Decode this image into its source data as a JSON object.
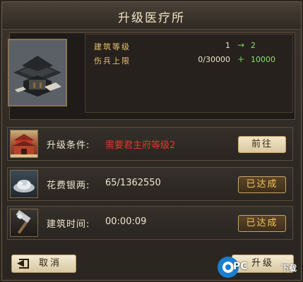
{
  "dialog": {
    "title": "升级医疗所"
  },
  "stats": [
    {
      "label": "建筑等级",
      "current": "1",
      "operator": "→",
      "next": "2"
    },
    {
      "label": "伤兵上限",
      "current": "0/30000",
      "operator": "+",
      "next": "10000"
    }
  ],
  "requirement": {
    "label": "升级条件:",
    "value": "需要君主府等级2",
    "value_color": "#e0392b",
    "button": "前往"
  },
  "cost": {
    "label": "花费银两:",
    "value": "65/1362550",
    "status": "已达成"
  },
  "build_time": {
    "label": "建筑时间:",
    "value": "00:00:09",
    "status": "已达成"
  },
  "footer": {
    "cancel_label": "取消",
    "upgrade_label": "升级"
  },
  "watermark": {
    "brand": "PC",
    "text": "下载"
  }
}
